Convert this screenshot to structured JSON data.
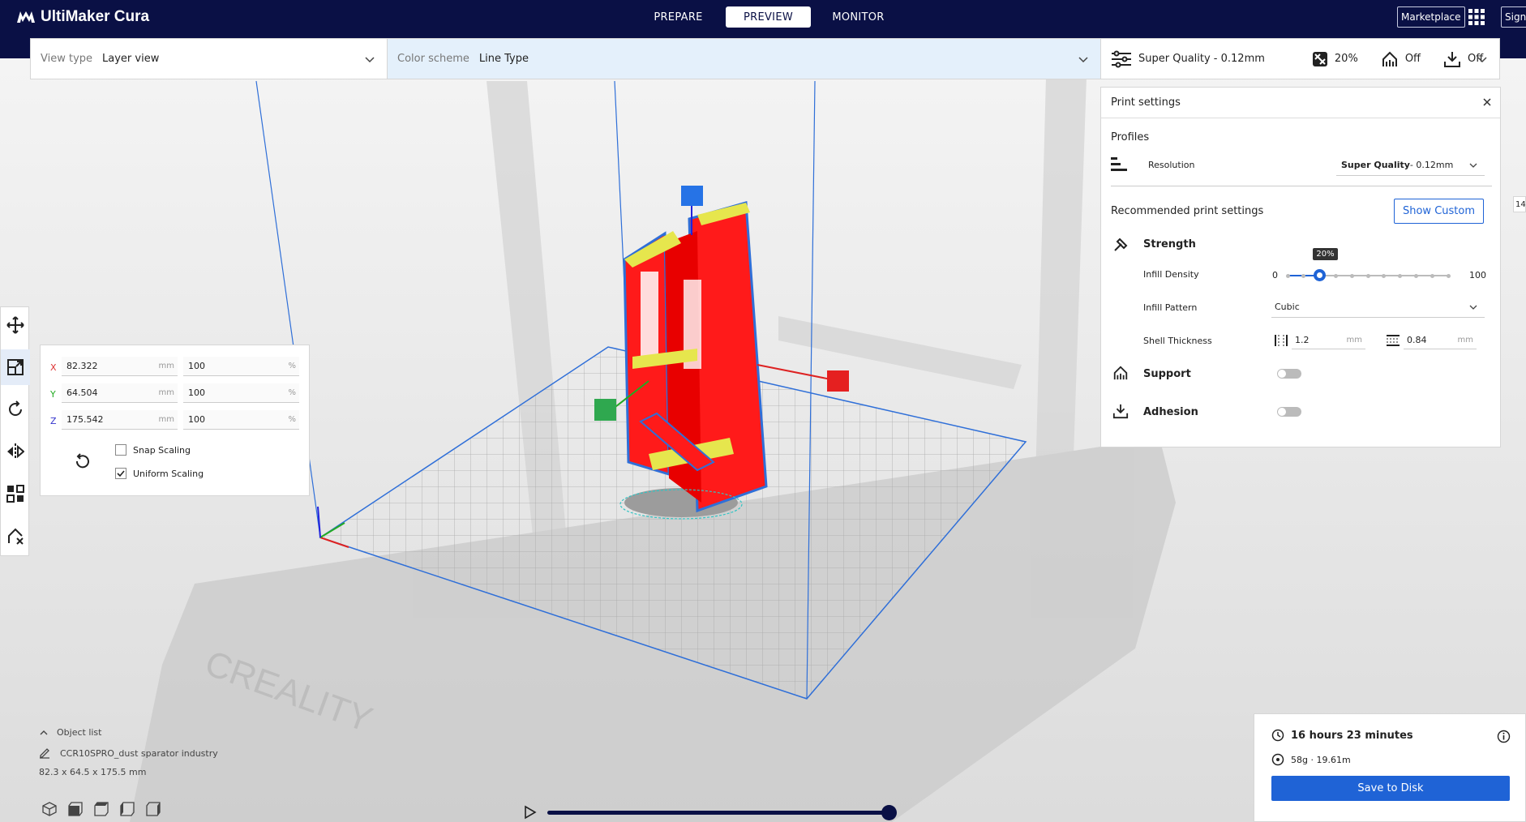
{
  "app": {
    "name": "UltiMaker Cura"
  },
  "nav": {
    "tabs": [
      {
        "label": "PREPARE"
      },
      {
        "label": "PREVIEW"
      },
      {
        "label": "MONITOR"
      }
    ],
    "active_tab": "PREVIEW",
    "marketplace": "Marketplace",
    "signin": "Sign in"
  },
  "viewbar": {
    "view_type_label": "View type",
    "view_type_value": "Layer view",
    "color_scheme_label": "Color scheme",
    "color_scheme_value": "Line Type",
    "quality_value": "Super Quality - 0.12mm",
    "infill_value": "20%",
    "support_value": "Off",
    "adhesion_value": "Off"
  },
  "print_settings": {
    "title": "Print settings",
    "profiles_label": "Profiles",
    "resolution_label": "Resolution",
    "resolution_value_bold": "Super Quality",
    "resolution_value_rest": " - 0.12mm",
    "recommended_label": "Recommended print settings",
    "show_custom": "Show Custom",
    "strength_label": "Strength",
    "infill_density_label": "Infill Density",
    "infill_min": "0",
    "infill_max": "100",
    "infill_value": 20,
    "infill_tooltip": "20%",
    "infill_pattern_label": "Infill Pattern",
    "infill_pattern_value": "Cubic",
    "shell_thickness_label": "Shell Thickness",
    "shell_wall_value": "1.2",
    "shell_top_value": "0.84",
    "unit_mm": "mm",
    "support_label": "Support",
    "adhesion_label": "Adhesion"
  },
  "scale": {
    "x_label": "X",
    "x_mm": "82.322",
    "x_pct": "100",
    "y_label": "Y",
    "y_mm": "64.504",
    "y_pct": "100",
    "z_label": "Z",
    "z_mm": "175.542",
    "z_pct": "100",
    "unit_mm": "mm",
    "unit_pct": "%",
    "snap_scaling": "Snap Scaling",
    "uniform_scaling": "Uniform Scaling"
  },
  "object_list": {
    "label": "Object list",
    "object_name": "CCR10SPRO_dust sparator industry",
    "dimensions": "82.3 x 64.5 x 175.5 mm"
  },
  "summary": {
    "time": "16 hours 23 minutes",
    "material": "58g · 19.61m",
    "save": "Save to Disk"
  },
  "layer_slider_top": "14",
  "colors": {
    "header": "#0a1045",
    "accent": "#1f63d6",
    "model": "#ff1a1a",
    "outline": "#2f6fd8",
    "infill": "#e6e64d"
  }
}
